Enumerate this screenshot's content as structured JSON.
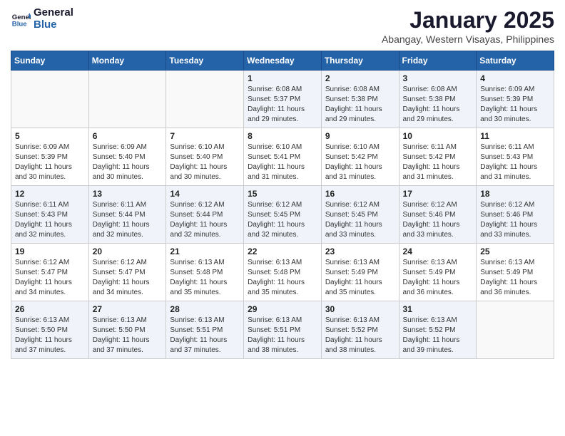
{
  "header": {
    "logo_line1": "General",
    "logo_line2": "Blue",
    "month": "January 2025",
    "location": "Abangay, Western Visayas, Philippines"
  },
  "weekdays": [
    "Sunday",
    "Monday",
    "Tuesday",
    "Wednesday",
    "Thursday",
    "Friday",
    "Saturday"
  ],
  "weeks": [
    [
      {
        "day": "",
        "info": ""
      },
      {
        "day": "",
        "info": ""
      },
      {
        "day": "",
        "info": ""
      },
      {
        "day": "1",
        "info": "Sunrise: 6:08 AM\nSunset: 5:37 PM\nDaylight: 11 hours\nand 29 minutes."
      },
      {
        "day": "2",
        "info": "Sunrise: 6:08 AM\nSunset: 5:38 PM\nDaylight: 11 hours\nand 29 minutes."
      },
      {
        "day": "3",
        "info": "Sunrise: 6:08 AM\nSunset: 5:38 PM\nDaylight: 11 hours\nand 29 minutes."
      },
      {
        "day": "4",
        "info": "Sunrise: 6:09 AM\nSunset: 5:39 PM\nDaylight: 11 hours\nand 30 minutes."
      }
    ],
    [
      {
        "day": "5",
        "info": "Sunrise: 6:09 AM\nSunset: 5:39 PM\nDaylight: 11 hours\nand 30 minutes."
      },
      {
        "day": "6",
        "info": "Sunrise: 6:09 AM\nSunset: 5:40 PM\nDaylight: 11 hours\nand 30 minutes."
      },
      {
        "day": "7",
        "info": "Sunrise: 6:10 AM\nSunset: 5:40 PM\nDaylight: 11 hours\nand 30 minutes."
      },
      {
        "day": "8",
        "info": "Sunrise: 6:10 AM\nSunset: 5:41 PM\nDaylight: 11 hours\nand 31 minutes."
      },
      {
        "day": "9",
        "info": "Sunrise: 6:10 AM\nSunset: 5:42 PM\nDaylight: 11 hours\nand 31 minutes."
      },
      {
        "day": "10",
        "info": "Sunrise: 6:11 AM\nSunset: 5:42 PM\nDaylight: 11 hours\nand 31 minutes."
      },
      {
        "day": "11",
        "info": "Sunrise: 6:11 AM\nSunset: 5:43 PM\nDaylight: 11 hours\nand 31 minutes."
      }
    ],
    [
      {
        "day": "12",
        "info": "Sunrise: 6:11 AM\nSunset: 5:43 PM\nDaylight: 11 hours\nand 32 minutes."
      },
      {
        "day": "13",
        "info": "Sunrise: 6:11 AM\nSunset: 5:44 PM\nDaylight: 11 hours\nand 32 minutes."
      },
      {
        "day": "14",
        "info": "Sunrise: 6:12 AM\nSunset: 5:44 PM\nDaylight: 11 hours\nand 32 minutes."
      },
      {
        "day": "15",
        "info": "Sunrise: 6:12 AM\nSunset: 5:45 PM\nDaylight: 11 hours\nand 32 minutes."
      },
      {
        "day": "16",
        "info": "Sunrise: 6:12 AM\nSunset: 5:45 PM\nDaylight: 11 hours\nand 33 minutes."
      },
      {
        "day": "17",
        "info": "Sunrise: 6:12 AM\nSunset: 5:46 PM\nDaylight: 11 hours\nand 33 minutes."
      },
      {
        "day": "18",
        "info": "Sunrise: 6:12 AM\nSunset: 5:46 PM\nDaylight: 11 hours\nand 33 minutes."
      }
    ],
    [
      {
        "day": "19",
        "info": "Sunrise: 6:12 AM\nSunset: 5:47 PM\nDaylight: 11 hours\nand 34 minutes."
      },
      {
        "day": "20",
        "info": "Sunrise: 6:12 AM\nSunset: 5:47 PM\nDaylight: 11 hours\nand 34 minutes."
      },
      {
        "day": "21",
        "info": "Sunrise: 6:13 AM\nSunset: 5:48 PM\nDaylight: 11 hours\nand 35 minutes."
      },
      {
        "day": "22",
        "info": "Sunrise: 6:13 AM\nSunset: 5:48 PM\nDaylight: 11 hours\nand 35 minutes."
      },
      {
        "day": "23",
        "info": "Sunrise: 6:13 AM\nSunset: 5:49 PM\nDaylight: 11 hours\nand 35 minutes."
      },
      {
        "day": "24",
        "info": "Sunrise: 6:13 AM\nSunset: 5:49 PM\nDaylight: 11 hours\nand 36 minutes."
      },
      {
        "day": "25",
        "info": "Sunrise: 6:13 AM\nSunset: 5:49 PM\nDaylight: 11 hours\nand 36 minutes."
      }
    ],
    [
      {
        "day": "26",
        "info": "Sunrise: 6:13 AM\nSunset: 5:50 PM\nDaylight: 11 hours\nand 37 minutes."
      },
      {
        "day": "27",
        "info": "Sunrise: 6:13 AM\nSunset: 5:50 PM\nDaylight: 11 hours\nand 37 minutes."
      },
      {
        "day": "28",
        "info": "Sunrise: 6:13 AM\nSunset: 5:51 PM\nDaylight: 11 hours\nand 37 minutes."
      },
      {
        "day": "29",
        "info": "Sunrise: 6:13 AM\nSunset: 5:51 PM\nDaylight: 11 hours\nand 38 minutes."
      },
      {
        "day": "30",
        "info": "Sunrise: 6:13 AM\nSunset: 5:52 PM\nDaylight: 11 hours\nand 38 minutes."
      },
      {
        "day": "31",
        "info": "Sunrise: 6:13 AM\nSunset: 5:52 PM\nDaylight: 11 hours\nand 39 minutes."
      },
      {
        "day": "",
        "info": ""
      }
    ]
  ]
}
